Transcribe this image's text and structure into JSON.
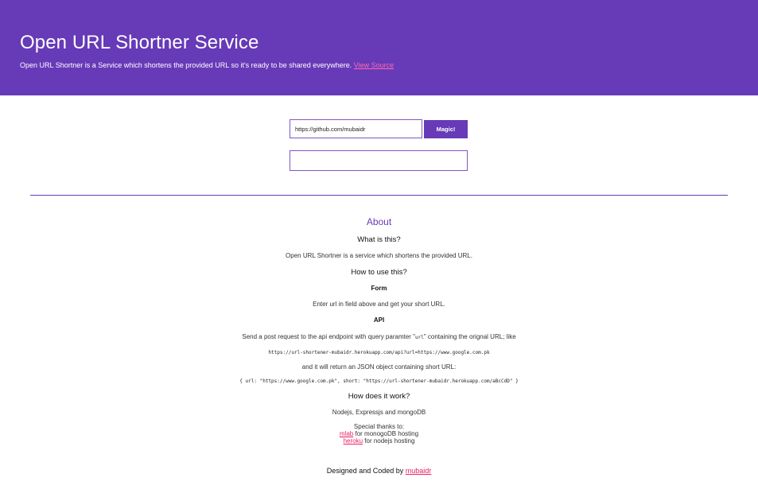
{
  "header": {
    "title": "Open URL Shortner Service",
    "description": "Open URL Shortner is a Service which shortens the provided URL so it's ready to be shared everywhere.",
    "source_link": "View Source",
    "bg_color": "#673ab7",
    "link_color": "#ff69b4"
  },
  "form": {
    "url_value": "https://github.com/mubaidr",
    "submit_label": "Magic!",
    "result_value": ""
  },
  "about": {
    "title": "About",
    "what_heading": "What is this?",
    "what_text": "Open URL Shortner is a service which shortens the provided URL.",
    "how_heading": "How to use this?",
    "form_heading": "Form",
    "form_text": "Enter url in field above and get your short URL.",
    "api_heading": "API",
    "api_text_before": "Send a post request to the api endpoint with query paramter \"",
    "api_param": "url",
    "api_text_after": "\" containing the orignal URL; like",
    "api_example": "https://url-shortener-mubaidr.herokuapp.com/api?url=https://www.google.com.pk",
    "api_return_text": "and it will return an JSON object containing short URL:",
    "api_return_example": "{ url: \"https://www.google.com.pk\", short: \"https://url-shortener-mubaidr.herokuapp.com/aBcCdD\" }",
    "works_heading": "How does it work?",
    "works_text": "Nodejs, Expressjs and mongoDB",
    "thanks_label": "Special thanks to:",
    "thanks_1_link": "mlab",
    "thanks_1_text": " for monogoDB hosting",
    "thanks_2_link": "heroku",
    "thanks_2_text": " for nodejs hosting"
  },
  "footer": {
    "text": "Designed and Coded by ",
    "author_link": "mubaidr"
  }
}
